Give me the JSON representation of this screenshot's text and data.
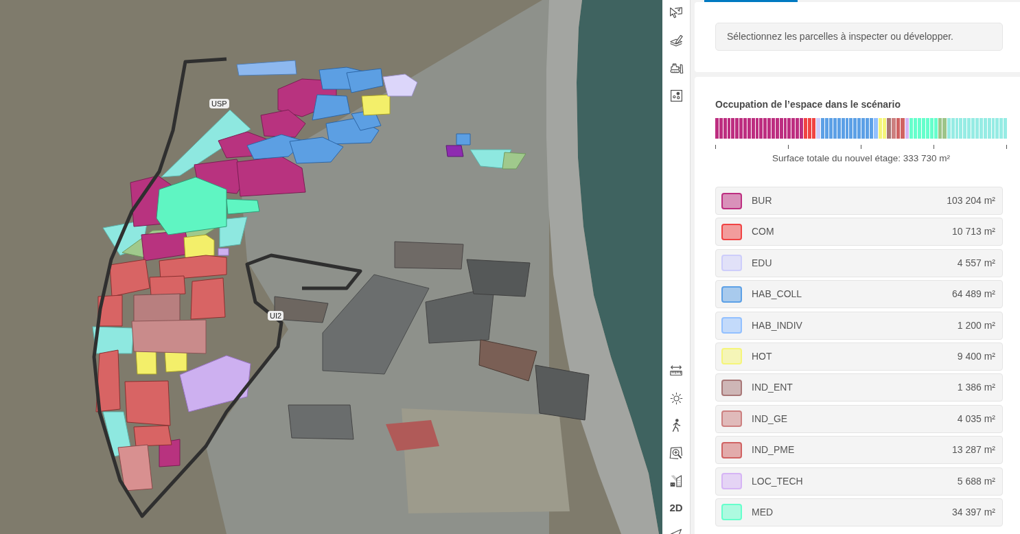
{
  "map": {
    "labels": [
      {
        "text": "USP"
      },
      {
        "text": "UI2"
      }
    ]
  },
  "toolbar": {
    "view_mode_button": "2D"
  },
  "selection_card": {
    "message": "Sélectionnez les parcelles à inspecter ou développer."
  },
  "usage_card": {
    "title": "Occupation de l’espace dans le scénario",
    "total": "Surface totale du nouvel étage: 333 730 m²",
    "legend": [
      {
        "label": "BUR",
        "area": "103 204 m²",
        "color": "#bd2e80"
      },
      {
        "label": "COM",
        "area": "10 713 m²",
        "color": "#f04343"
      },
      {
        "label": "EDU",
        "area": "4 557 m²",
        "color": "#cdcdfb"
      },
      {
        "label": "HAB_COLL",
        "area": "64 489 m²",
        "color": "#5ca0e6"
      },
      {
        "label": "HAB_INDIV",
        "area": "1 200 m²",
        "color": "#92c0ff"
      },
      {
        "label": "HOT",
        "area": "9 400 m²",
        "color": "#f5f57a"
      },
      {
        "label": "IND_ENT",
        "area": "1 386 m²",
        "color": "#a87777"
      },
      {
        "label": "IND_GE",
        "area": "4 035 m²",
        "color": "#cc8080"
      },
      {
        "label": "IND_PME",
        "area": "13 287 m²",
        "color": "#d06262"
      },
      {
        "label": "LOC_TECH",
        "area": "5 688 m²",
        "color": "#d6b4f5"
      },
      {
        "label": "MED",
        "area": "34 397 m²",
        "color": "#66ffcc"
      }
    ]
  }
}
